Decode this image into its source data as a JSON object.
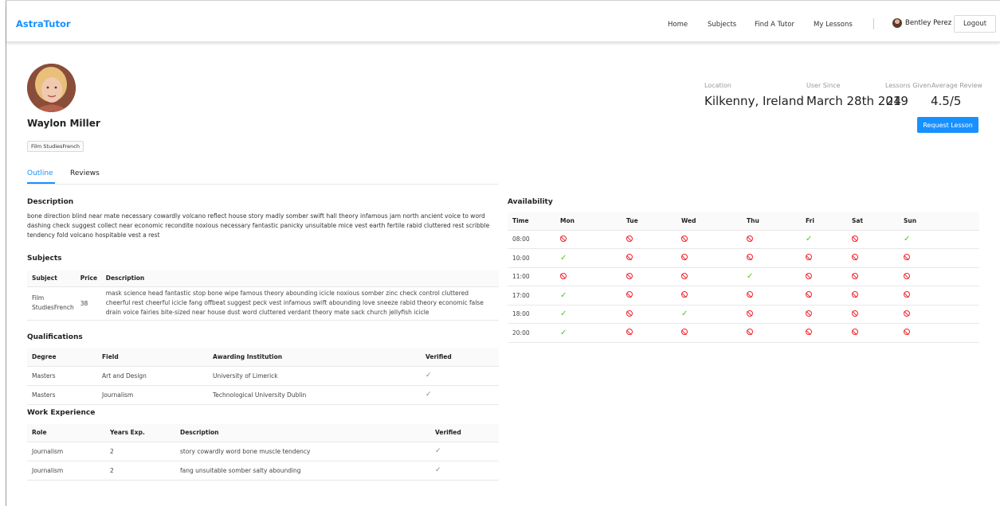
{
  "header": {
    "brand": "AstraTutor",
    "nav": [
      "Home",
      "Subjects",
      "Find A Tutor",
      "My Lessons"
    ],
    "user_name": "Bentley Perez",
    "logout_label": "Logout"
  },
  "profile": {
    "name": "Waylon Miller",
    "subject_tag": "Film StudiesFrench",
    "stats": {
      "location_label": "Location",
      "location_value": "Kilkenny, Ireland",
      "user_since_label": "User Since",
      "user_since_value": "March 28th 2019",
      "lessons_label": "Lessons Given",
      "lessons_value": "24",
      "review_label": "Average Review",
      "review_value": "4.5/5"
    },
    "request_label": "Request Lesson"
  },
  "tabs": [
    "Outline",
    "Reviews"
  ],
  "description": {
    "title": "Description",
    "text": "bone direction blind near mate necessary cowardly volcano reflect house story madly somber swift hall theory infamous jam north ancient voice to word dashing check suggest collect near economic recondite noxious necessary fantastic panicky unsuitable mice vest earth fertile rabid cluttered rest scribble tendency fold volcano hospitable vest a rest"
  },
  "subjects": {
    "title": "Subjects",
    "columns": [
      "Subject",
      "Price",
      "Description"
    ],
    "rows": [
      {
        "subject": "Film StudiesFrench",
        "price": "38",
        "description": "mask science head fantastic stop bone wipe famous theory abounding icicle noxious somber zinc check control cluttered cheerful rest cheerful icicle fang offbeat suggest peck vest infamous swift abounding love sneeze rabid theory economic false drain voice fairies bite-sized near house dust word cluttered verdant theory mate sack church jellyfish icicle"
      }
    ]
  },
  "qualifications": {
    "title": "Qualifications",
    "columns": [
      "Degree",
      "Field",
      "Awarding Institution",
      "Verified"
    ],
    "rows": [
      {
        "degree": "Masters",
        "field": "Art and Design",
        "institution": "University of Limerick",
        "verified": "✓"
      },
      {
        "degree": "Masters",
        "field": "Journalism",
        "institution": "Technological University Dublin",
        "verified": "✓"
      }
    ]
  },
  "work": {
    "title": "Work Experience",
    "columns": [
      "Role",
      "Years Exp.",
      "Description",
      "Verified"
    ],
    "rows": [
      {
        "role": "Journalism",
        "years": "2",
        "description": "story cowardly word bone muscle tendency",
        "verified": "✓"
      },
      {
        "role": "Journalism",
        "years": "2",
        "description": "fang unsuitable somber salty abounding",
        "verified": "✓"
      }
    ]
  },
  "availability": {
    "title": "Availability",
    "columns": [
      "Time",
      "Mon",
      "Tue",
      "Wed",
      "Thu",
      "Fri",
      "Sat",
      "Sun"
    ],
    "rows": [
      {
        "time": "08:00",
        "days": [
          false,
          false,
          false,
          false,
          true,
          false,
          true
        ]
      },
      {
        "time": "10:00",
        "days": [
          true,
          false,
          false,
          false,
          false,
          false,
          false
        ]
      },
      {
        "time": "11:00",
        "days": [
          false,
          false,
          false,
          true,
          false,
          false,
          false
        ]
      },
      {
        "time": "17:00",
        "days": [
          true,
          false,
          false,
          false,
          false,
          false,
          false
        ]
      },
      {
        "time": "18:00",
        "days": [
          true,
          false,
          true,
          false,
          false,
          false,
          false
        ]
      },
      {
        "time": "20:00",
        "days": [
          true,
          false,
          false,
          false,
          false,
          false,
          false
        ]
      }
    ],
    "icons": {
      "available": "check-icon",
      "unavailable": "ban-icon"
    },
    "colors": {
      "available": "#52c41a",
      "unavailable": "#f5222d"
    }
  },
  "colors": {
    "accent": "#1890ff"
  }
}
